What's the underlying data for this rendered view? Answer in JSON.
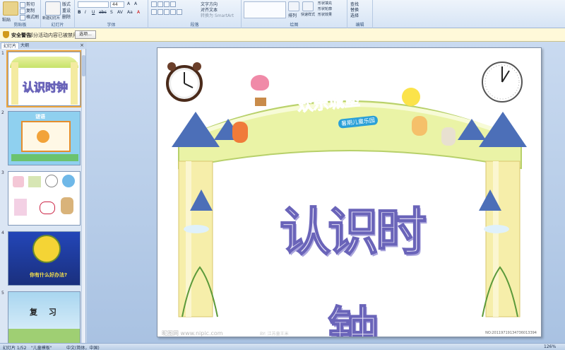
{
  "ribbon": {
    "groups": [
      {
        "name": "剪贴板",
        "items": [
          "粘贴",
          "剪切",
          "复制",
          "格式刷"
        ]
      },
      {
        "name": "幻灯片",
        "items": [
          "新建幻灯片",
          "版式",
          "重设",
          "删除"
        ]
      },
      {
        "name": "字体",
        "items": [
          "44",
          "A",
          "A",
          "B",
          "I",
          "U",
          "abc",
          "S",
          "AV",
          "Aa",
          "A"
        ]
      },
      {
        "name": "段落",
        "items": [
          "文字方向",
          "对齐文本",
          "转换为 SmartArt"
        ]
      },
      {
        "name": "绘图",
        "items": [
          "排列",
          "快速样式",
          "形状填充",
          "形状轮廓",
          "形状效果"
        ]
      },
      {
        "name": "编辑",
        "items": [
          "查找",
          "替换",
          "选择"
        ]
      }
    ],
    "font_size": "44"
  },
  "security_bar": {
    "title": "安全警告",
    "message": "部分活动内容已被禁用。",
    "options_button": "选项..."
  },
  "left_pane": {
    "tabs": [
      "幻灯片",
      "大纲"
    ],
    "close_glyph": "×",
    "slides": [
      {
        "num": "1",
        "text": "认识时钟"
      },
      {
        "num": "2",
        "text": "谜语"
      },
      {
        "num": "3",
        "text": ""
      },
      {
        "num": "4",
        "text": "你有什么好办法?"
      },
      {
        "num": "5",
        "text": "复 习"
      }
    ]
  },
  "slide": {
    "banner": "欢乐城堡",
    "banner_sub": "暑期儿童乐园",
    "title": "认识时钟",
    "watermark": "昵图网 www.nipic.com",
    "watermark2": "BY: 江苏童王米",
    "image_id": "NO:20119719134736013394"
  },
  "status_bar": {
    "slide_info": "幻灯片 1/52",
    "theme": "\"儿童模板\"",
    "language": "中文(简体，中国)",
    "zoom": "126%"
  }
}
